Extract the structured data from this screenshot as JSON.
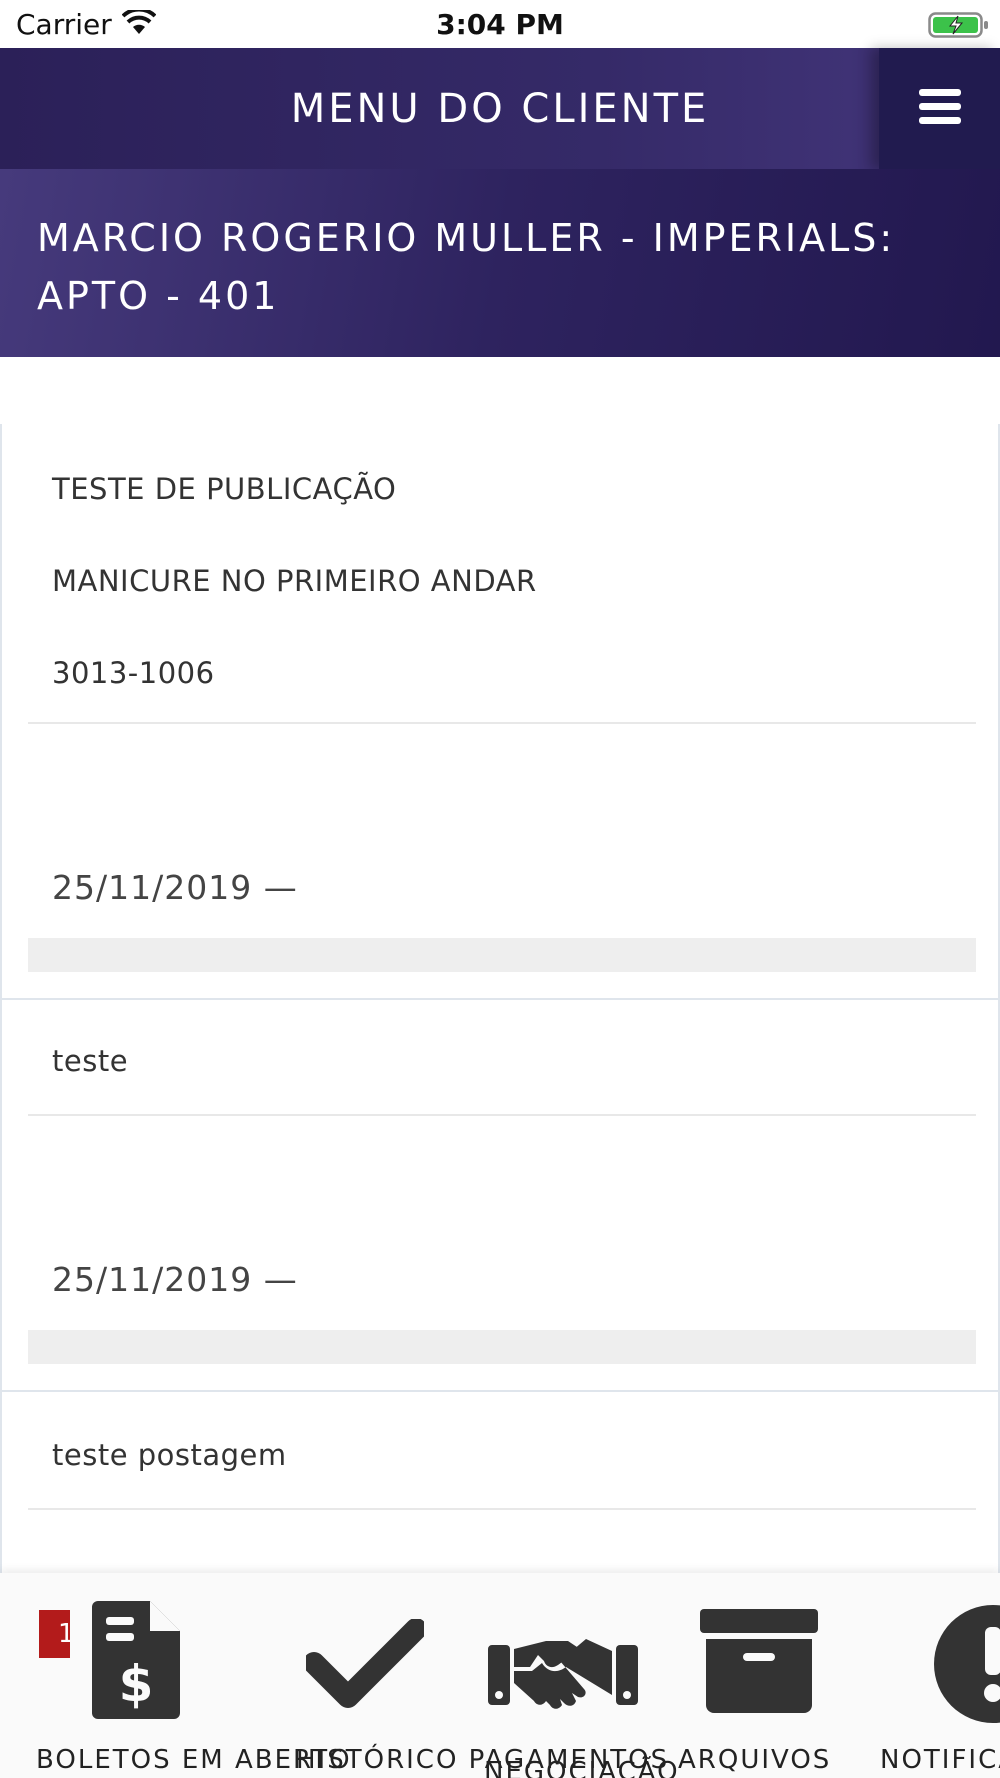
{
  "status_bar": {
    "carrier": "Carrier",
    "time": "3:04 PM"
  },
  "header": {
    "title": "MENU DO CLIENTE"
  },
  "client": {
    "name": "MARCIO ROGERIO MULLER - IMPERIALS: APTO - 401"
  },
  "posts": [
    {
      "lines": [
        "TESTE DE PUBLICAÇÃO",
        "MANICURE NO PRIMEIRO ANDAR",
        "3013-1006"
      ],
      "date": "25/11/2019 —"
    },
    {
      "lines": [
        "teste"
      ],
      "date": "25/11/2019 —"
    },
    {
      "lines": [
        "teste postagem"
      ],
      "date": ""
    }
  ],
  "tabbar": {
    "badge_count": "1",
    "tabs": [
      {
        "label": "BOLETOS EM ABERTO",
        "icon": "invoice-dollar-icon"
      },
      {
        "label": "HISTÓRICO PAGAMENTOS",
        "icon": "checkmark-icon"
      },
      {
        "label": "NEGOCIAÇÃO",
        "icon": "handshake-icon"
      },
      {
        "label": "ARQUIVOS",
        "icon": "archive-box-icon"
      },
      {
        "label": "NOTIFICAÇÕES",
        "icon": "alert-icon"
      }
    ]
  },
  "colors": {
    "header_bg": "#2b2058",
    "menu_btn_bg": "#211b4f",
    "badge": "#b31b1b",
    "icon": "#333333"
  }
}
